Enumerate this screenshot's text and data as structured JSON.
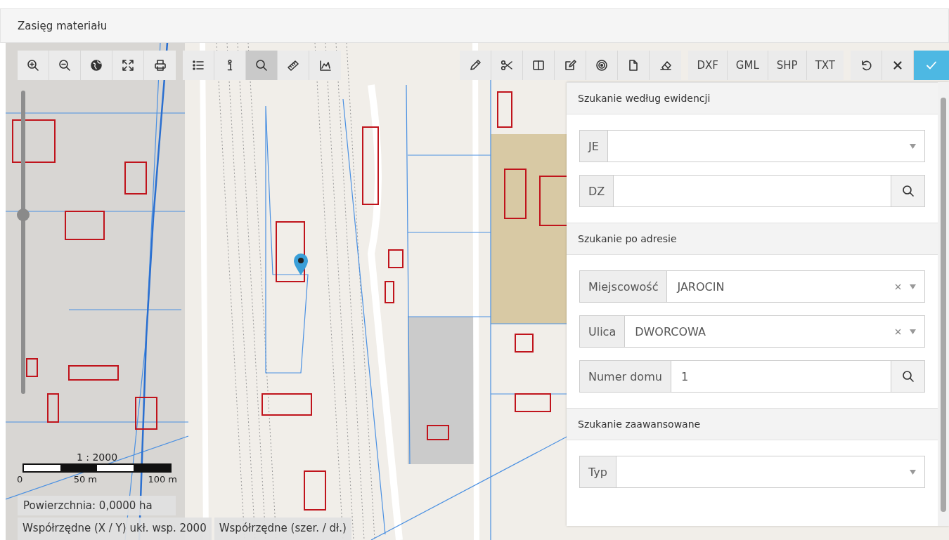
{
  "header": {
    "title": "Zasięg materiału"
  },
  "toolbar": {
    "groups": [
      {
        "buttons": [
          {
            "kind": "icon",
            "selected": false
          },
          {
            "kind": "icon",
            "selected": false
          },
          {
            "kind": "icon",
            "selected": false
          },
          {
            "kind": "icon",
            "selected": false
          },
          {
            "kind": "icon",
            "selected": false
          }
        ]
      },
      {
        "buttons": [
          {
            "kind": "icon",
            "selected": false
          },
          {
            "kind": "icon",
            "selected": false
          },
          {
            "kind": "icon",
            "selected": true
          },
          {
            "kind": "icon",
            "selected": false
          },
          {
            "kind": "icon",
            "selected": false
          }
        ]
      },
      {
        "buttons": [
          {
            "kind": "icon",
            "selected": false
          },
          {
            "kind": "icon",
            "selected": false
          },
          {
            "kind": "icon",
            "selected": false
          },
          {
            "kind": "icon",
            "selected": false
          },
          {
            "kind": "icon",
            "selected": false
          },
          {
            "kind": "icon",
            "selected": false
          },
          {
            "kind": "icon",
            "selected": false
          }
        ]
      },
      {
        "buttons": [
          {
            "kind": "text",
            "label": "DXF",
            "selected": false
          },
          {
            "kind": "text",
            "label": "GML",
            "selected": false
          },
          {
            "kind": "text",
            "label": "SHP",
            "selected": false
          },
          {
            "kind": "text",
            "label": "TXT",
            "selected": false
          }
        ]
      },
      {
        "buttons": [
          {
            "kind": "icon",
            "selected": false
          },
          {
            "kind": "icon",
            "selected": false
          },
          {
            "kind": "primary"
          }
        ]
      }
    ]
  },
  "zoom_slider": {
    "level": 0.59
  },
  "scale": {
    "ratio": "1 : 2000",
    "ticks": [
      "0",
      "50 m",
      "100 m"
    ]
  },
  "area_readout": "Powierzchnia: 0,0000 ha",
  "coordinates": [
    "Współrzędne (X / Y) ukł. wsp. 2000",
    "Współrzędne (szer. / dł.)"
  ],
  "search_panel": {
    "sections": [
      {
        "title": "Szukanie według ewidencji",
        "fields": [
          {
            "kind": "select",
            "label": "JE",
            "clearable": false
          },
          {
            "kind": "search",
            "label": "DZ"
          }
        ]
      },
      {
        "title": "Szukanie po adresie",
        "fields": [
          {
            "kind": "select",
            "label": "Miejscowość",
            "value": "JAROCIN",
            "clearable": true
          },
          {
            "kind": "select",
            "label": "Ulica",
            "value": "DWORCOWA",
            "clearable": true
          },
          {
            "kind": "search",
            "label": "Numer domu",
            "value": "1"
          }
        ]
      },
      {
        "title": "Szukanie zaawansowane",
        "fields": [
          {
            "kind": "select",
            "label": "Typ",
            "clearable": false
          }
        ]
      }
    ]
  }
}
